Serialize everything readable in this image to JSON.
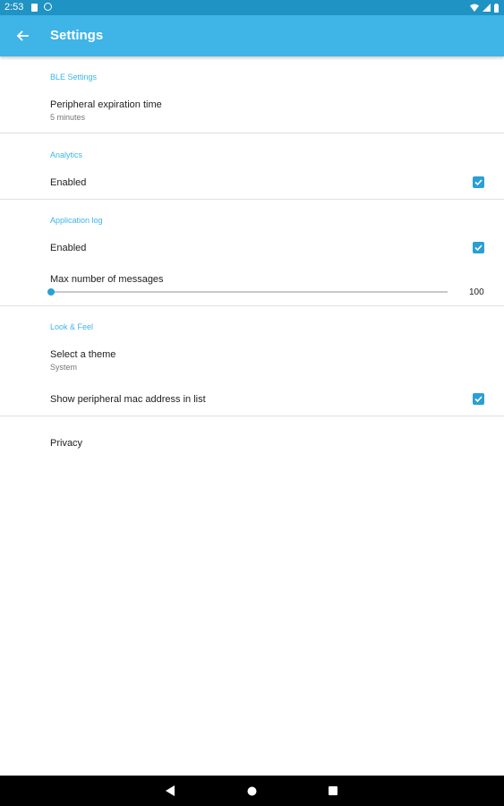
{
  "status_bar": {
    "time": "2:53"
  },
  "app_bar": {
    "title": "Settings",
    "back_icon": "arrow-back-icon"
  },
  "sections": {
    "ble": {
      "title": "BLE Settings",
      "peripheral_expiration": {
        "title": "Peripheral expiration time",
        "value": "5 minutes"
      }
    },
    "analytics": {
      "title": "Analytics",
      "enabled": {
        "title": "Enabled",
        "checked": true
      }
    },
    "application_log": {
      "title": "Application log",
      "enabled": {
        "title": "Enabled",
        "checked": true
      },
      "max_messages": {
        "title": "Max number of messages",
        "value": "100",
        "slider_fraction": 0.0
      }
    },
    "look_feel": {
      "title": "Look & Feel",
      "theme": {
        "title": "Select a theme",
        "value": "System"
      },
      "show_mac": {
        "title": "Show peripheral mac address in list",
        "checked": true
      }
    },
    "privacy": {
      "title": "Privacy"
    }
  },
  "colors": {
    "accent": "#3eb4e7",
    "status_bar": "#1f93c3",
    "checkbox": "#2a9fd6"
  },
  "nav_bar": {
    "back_icon": "triangle-back-icon",
    "home_icon": "circle-home-icon",
    "recents_icon": "square-recents-icon"
  }
}
